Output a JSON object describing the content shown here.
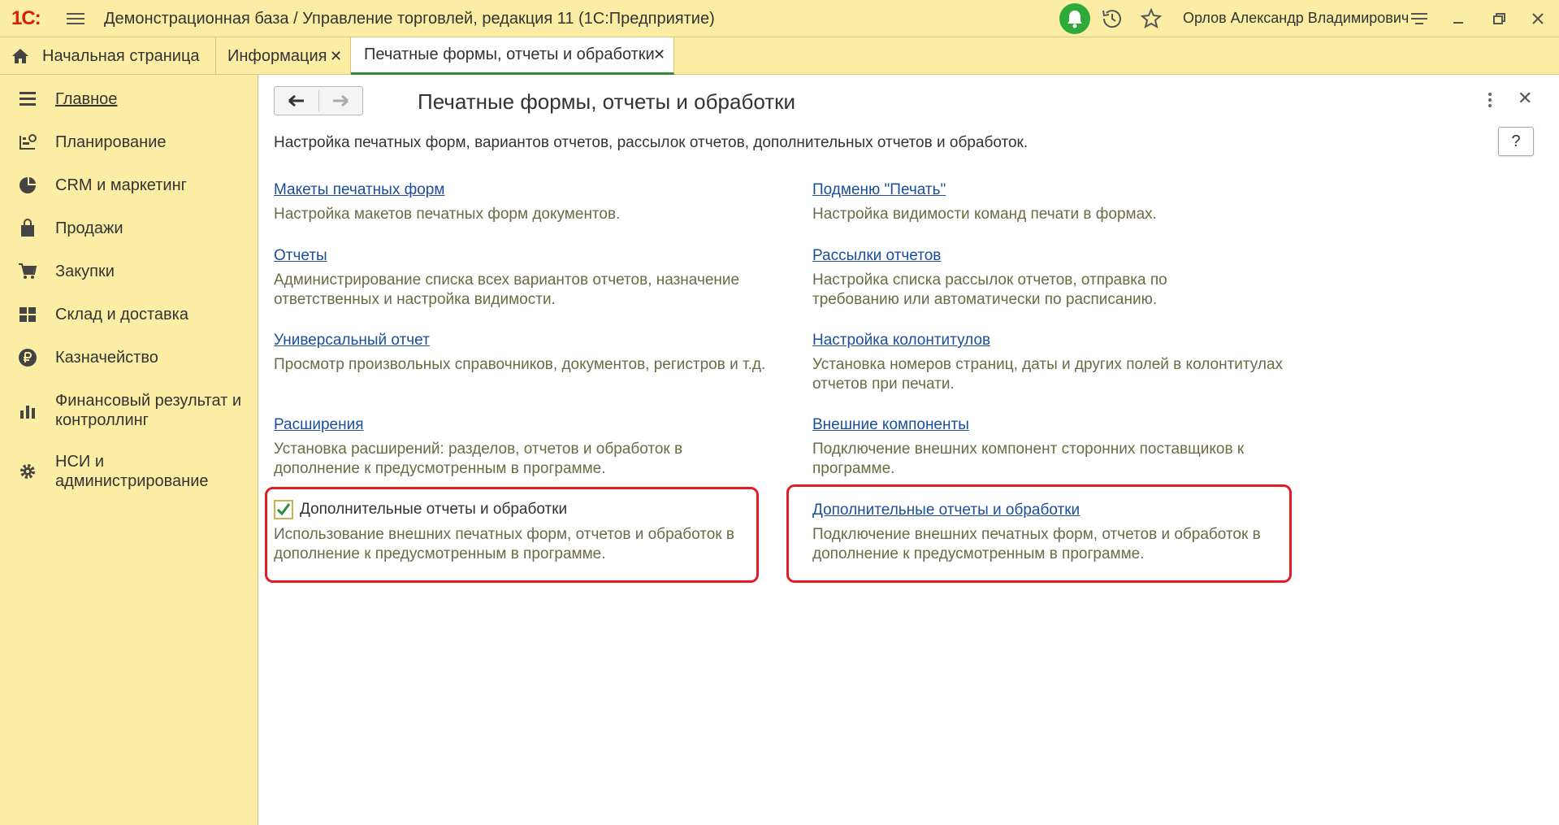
{
  "app": {
    "logo": "1С:",
    "title": "Демонстрационная база / Управление торговлей, редакция 11  (1С:Предприятие)",
    "user": "Орлов Александр Владимирович"
  },
  "tabs": [
    {
      "label": "Начальная страница",
      "closable": false
    },
    {
      "label": "Информация",
      "closable": true,
      "close": "✕"
    },
    {
      "label": "Печатные формы, отчеты и обработки",
      "closable": true,
      "close": "✕",
      "active": true
    }
  ],
  "sidebar": {
    "items": [
      {
        "label": "Главное",
        "icon": "menu-icon",
        "active": true
      },
      {
        "label": "Планирование",
        "icon": "planning-icon"
      },
      {
        "label": "CRM и маркетинг",
        "icon": "pie-chart-icon"
      },
      {
        "label": "Продажи",
        "icon": "shopping-bag-icon"
      },
      {
        "label": "Закупки",
        "icon": "cart-icon"
      },
      {
        "label": "Склад и доставка",
        "icon": "warehouse-icon"
      },
      {
        "label": "Казначейство",
        "icon": "ruble-icon"
      },
      {
        "label": "Финансовый результат и контроллинг",
        "icon": "bar-chart-icon"
      },
      {
        "label": "НСИ и администрирование",
        "icon": "gear-icon"
      }
    ]
  },
  "form": {
    "title": "Печатные формы, отчеты и обработки",
    "description": "Настройка печатных форм, вариантов отчетов, рассылок отчетов, дополнительных отчетов и обработок.",
    "help": "?",
    "close": "✕",
    "left_entries": [
      {
        "link": "Макеты печатных форм",
        "desc": "Настройка макетов печатных форм документов."
      },
      {
        "link": "Отчеты",
        "desc": "Администрирование списка всех вариантов отчетов, назначение ответственных и настройка видимости."
      },
      {
        "link": "Универсальный отчет",
        "desc": "Просмотр произвольных справочников, документов, регистров и т.д."
      },
      {
        "link": "Расширения",
        "desc": "Установка расширений: разделов, отчетов и обработок в дополнение к предусмотренным в программе."
      }
    ],
    "right_entries": [
      {
        "link": "Подменю \"Печать\"",
        "desc": "Настройка видимости команд печати в формах."
      },
      {
        "link": "Рассылки отчетов",
        "desc": "Настройка списка рассылок отчетов, отправка по требованию или автоматически по расписанию."
      },
      {
        "link": "Настройка колонтитулов",
        "desc": "Установка номеров страниц, даты и других полей в колонтитулах отчетов при печати."
      },
      {
        "link": "Внешние компоненты",
        "desc": "Подключение внешних компонент сторонних поставщиков к программе."
      }
    ],
    "additional_checkbox": {
      "label": "Дополнительные отчеты и обработки",
      "checked": true,
      "desc": "Использование внешних печатных форм, отчетов и обработок в дополнение к предусмотренным в программе."
    },
    "additional_link": {
      "link": "Дополнительные отчеты и обработки",
      "desc": "Подключение внешних печатных форм, отчетов и обработок в дополнение к предусмотренным в программе."
    }
  },
  "colors": {
    "panel": "#fbeda4",
    "link": "#1a4e9c",
    "desc_text": "#6b6b45",
    "highlight": "#e01e26",
    "accent_green": "#2f8a3a",
    "bell_green": "#2eaa3a"
  }
}
